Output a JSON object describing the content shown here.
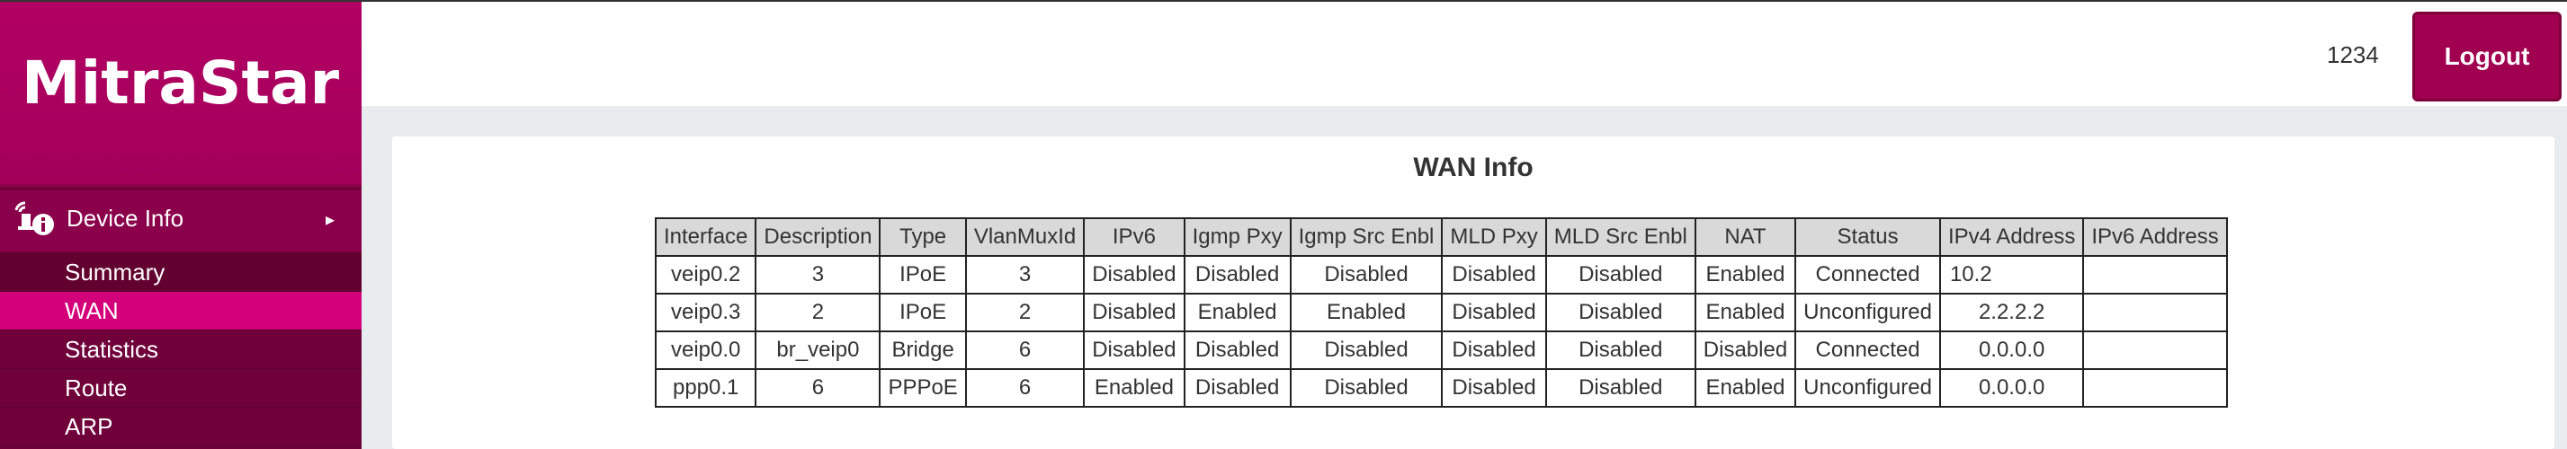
{
  "app": {
    "brand": "MitraStar"
  },
  "sidebar": {
    "section": {
      "label": "Device Info",
      "caret": "▸"
    },
    "items": [
      {
        "label": "Summary",
        "active": false
      },
      {
        "label": "WAN",
        "active": true
      },
      {
        "label": "Statistics",
        "active": false
      },
      {
        "label": "Route",
        "active": false
      },
      {
        "label": "ARP",
        "active": false
      }
    ]
  },
  "header": {
    "user": "1234",
    "logout_label": "Logout"
  },
  "main": {
    "title": "WAN Info",
    "table": {
      "headers": [
        "Interface",
        "Description",
        "Type",
        "VlanMuxId",
        "IPv6",
        "Igmp Pxy",
        "Igmp Src Enbl",
        "MLD Pxy",
        "MLD Src Enbl",
        "NAT",
        "Status",
        "IPv4 Address",
        "IPv6 Address"
      ],
      "rows": [
        [
          "veip0.2",
          "3",
          "IPoE",
          "3",
          "Disabled",
          "Disabled",
          "Disabled",
          "Disabled",
          "Disabled",
          "Enabled",
          "Connected",
          "10.2",
          ""
        ],
        [
          "veip0.3",
          "2",
          "IPoE",
          "2",
          "Disabled",
          "Enabled",
          "Enabled",
          "Disabled",
          "Disabled",
          "Enabled",
          "Unconfigured",
          "2.2.2.2",
          ""
        ],
        [
          "veip0.0",
          "br_veip0",
          "Bridge",
          "6",
          "Disabled",
          "Disabled",
          "Disabled",
          "Disabled",
          "Disabled",
          "Disabled",
          "Connected",
          "0.0.0.0",
          ""
        ],
        [
          "ppp0.1",
          "6",
          "PPPoE",
          "6",
          "Enabled",
          "Disabled",
          "Disabled",
          "Disabled",
          "Disabled",
          "Enabled",
          "Unconfigured",
          "0.0.0.0",
          ""
        ]
      ]
    }
  },
  "colors": {
    "brand": "#a2005a",
    "sidebar_bg": "#6f0039",
    "active_item": "#d4007a",
    "logout_bg": "#a0004f"
  }
}
